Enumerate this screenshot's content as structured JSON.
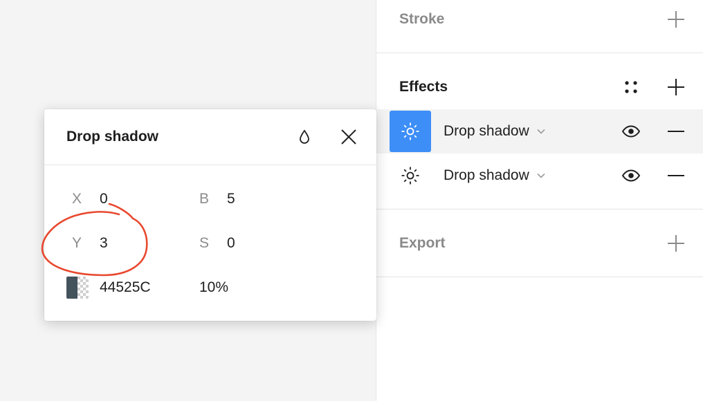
{
  "panel": {
    "stroke": {
      "title": "Stroke"
    },
    "effects": {
      "title": "Effects",
      "items": [
        {
          "label": "Drop shadow",
          "selected": true
        },
        {
          "label": "Drop shadow",
          "selected": false
        }
      ]
    },
    "export": {
      "title": "Export"
    }
  },
  "popover": {
    "title": "Drop shadow",
    "fields": {
      "x": {
        "label": "X",
        "value": "0"
      },
      "y": {
        "label": "Y",
        "value": "3"
      },
      "blur": {
        "label": "B",
        "value": "5"
      },
      "spread": {
        "label": "S",
        "value": "0"
      }
    },
    "color": {
      "hex": "44525C",
      "opacity": "10%"
    }
  },
  "colors": {
    "accent": "#3d8ef7",
    "annotation": "#e8482e",
    "swatch": "#44525c"
  },
  "icons": [
    "plus-icon",
    "style-grid-icon",
    "sun-effect-icon",
    "chevron-down-icon",
    "eye-icon",
    "minus-icon",
    "drop-icon",
    "close-icon"
  ]
}
